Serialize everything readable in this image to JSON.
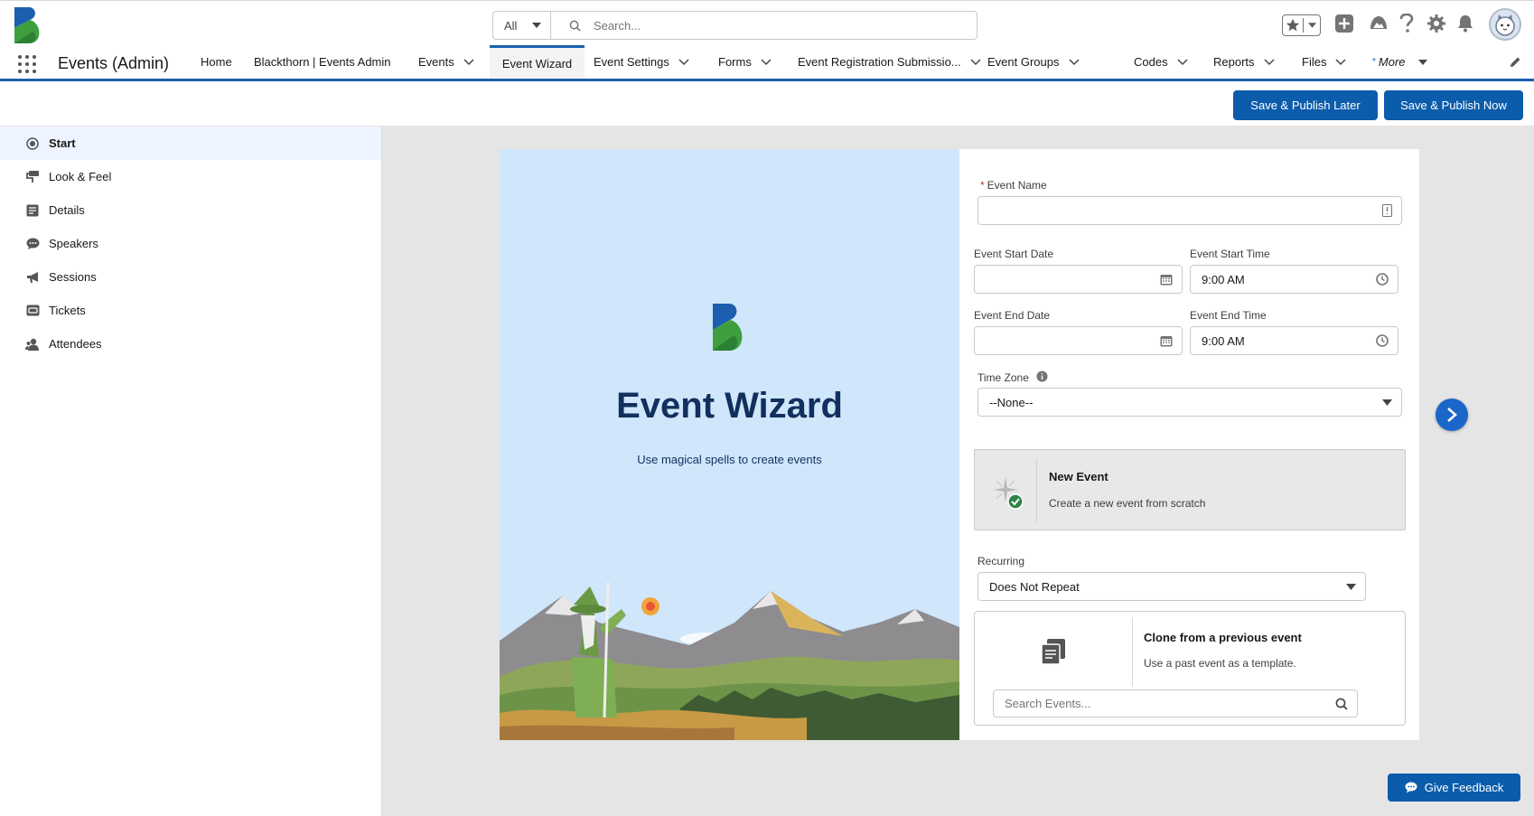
{
  "header": {
    "search_scope": "All",
    "search_placeholder": "Search..."
  },
  "nav": {
    "app_name": "Events (Admin)",
    "tabs": [
      {
        "label": "Home"
      },
      {
        "label": "Blackthorn | Events Admin"
      },
      {
        "label": "Events"
      },
      {
        "label": "Event Wizard"
      },
      {
        "label": "Event Settings"
      },
      {
        "label": "Forms"
      },
      {
        "label": "Event Registration Submissio..."
      },
      {
        "label": "Event Groups"
      },
      {
        "label": "Codes"
      },
      {
        "label": "Reports"
      },
      {
        "label": "Files"
      },
      {
        "label": "More"
      }
    ],
    "active_tab": "Event Wizard"
  },
  "actions": {
    "save_later": "Save & Publish Later",
    "save_now": "Save & Publish Now"
  },
  "sidebar": {
    "items": [
      {
        "label": "Start",
        "icon": "radio-target-icon"
      },
      {
        "label": "Look & Feel",
        "icon": "paint-icon"
      },
      {
        "label": "Details",
        "icon": "details-icon"
      },
      {
        "label": "Speakers",
        "icon": "chat-icon"
      },
      {
        "label": "Sessions",
        "icon": "megaphone-icon"
      },
      {
        "label": "Tickets",
        "icon": "ticket-icon"
      },
      {
        "label": "Attendees",
        "icon": "people-icon"
      }
    ],
    "active": "Start"
  },
  "hero": {
    "title": "Event Wizard",
    "subtitle": "Use magical spells to create events"
  },
  "form": {
    "event_name_label": "Event Name",
    "event_name_value": "",
    "start_date_label": "Event Start Date",
    "start_date_value": "",
    "start_time_label": "Event Start Time",
    "start_time_value": "9:00 AM",
    "end_date_label": "Event End Date",
    "end_date_value": "",
    "end_time_label": "Event End Time",
    "end_time_value": "9:00 AM",
    "timezone_label": "Time Zone",
    "timezone_value": "--None--",
    "new_event_title": "New Event",
    "new_event_desc": "Create a new event from scratch",
    "recurring_label": "Recurring",
    "recurring_value": "Does Not Repeat",
    "clone_title": "Clone from a previous event",
    "clone_desc": "Use a past event as a template.",
    "clone_search_placeholder": "Search Events..."
  },
  "feedback": {
    "label": "Give Feedback"
  },
  "colors": {
    "brand_blue": "#0b5cab",
    "nav_accent": "#1b5fae",
    "hero_bg": "#cfe6fb",
    "title_navy": "#12305e"
  }
}
